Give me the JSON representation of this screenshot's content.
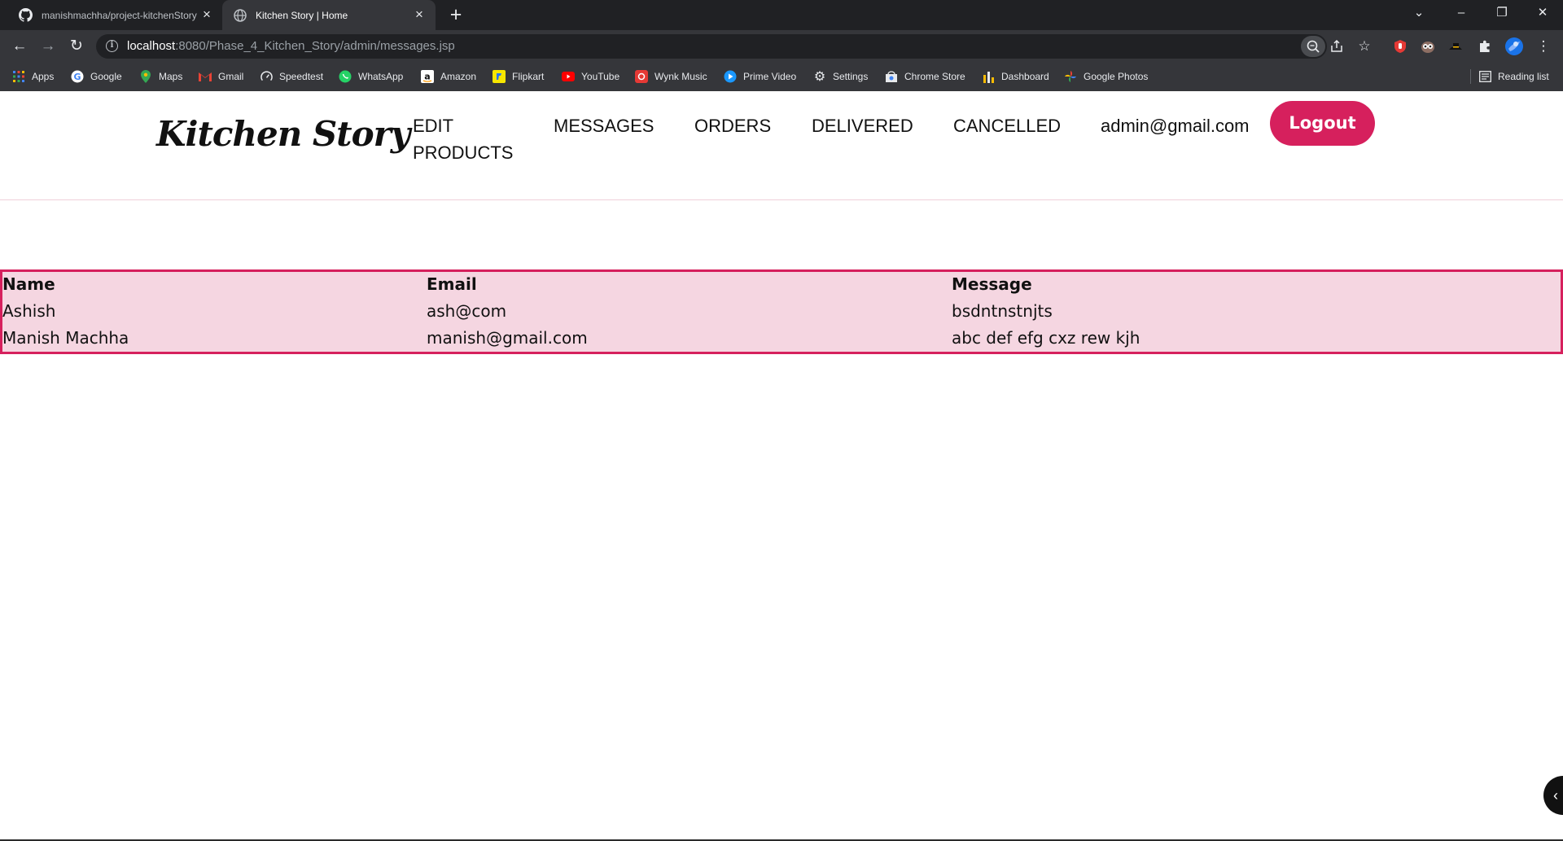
{
  "browser": {
    "tabs": [
      {
        "title": "manishmachha/project-kitchenStory",
        "icon": "github-icon"
      },
      {
        "title": "Kitchen Story | Home",
        "icon": "globe-icon"
      }
    ],
    "url_host": "localhost",
    "url_path": ":8080/Phase_4_Kitchen_Story/admin/messages.jsp",
    "bookmarks": [
      {
        "label": "Apps",
        "icon": "apps-grid-icon",
        "color": "#4285f4"
      },
      {
        "label": "Google",
        "icon": "google-icon",
        "color": "#4285f4"
      },
      {
        "label": "Maps",
        "icon": "maps-pin-icon",
        "color": "#34a853"
      },
      {
        "label": "Gmail",
        "icon": "gmail-icon",
        "color": "#ea4335"
      },
      {
        "label": "Speedtest",
        "icon": "speedtest-icon",
        "color": "#e8eaed"
      },
      {
        "label": "WhatsApp",
        "icon": "whatsapp-icon",
        "color": "#25d366"
      },
      {
        "label": "Amazon",
        "icon": "amazon-icon",
        "color": "#ffffff"
      },
      {
        "label": "Flipkart",
        "icon": "flipkart-icon",
        "color": "#f7e600"
      },
      {
        "label": "YouTube",
        "icon": "youtube-icon",
        "color": "#ff0000"
      },
      {
        "label": "Wynk Music",
        "icon": "wynk-icon",
        "color": "#e53935"
      },
      {
        "label": "Prime Video",
        "icon": "prime-video-icon",
        "color": "#1a98ff"
      },
      {
        "label": "Settings",
        "icon": "gear-icon",
        "color": "#e8eaed"
      },
      {
        "label": "Chrome Store",
        "icon": "chrome-store-icon",
        "color": "#e8eaed"
      },
      {
        "label": "Dashboard",
        "icon": "dashboard-icon",
        "color": "#fbbc04"
      },
      {
        "label": "Google Photos",
        "icon": "google-photos-icon",
        "color": "#fbbc04"
      }
    ],
    "reading_list": "Reading list"
  },
  "header": {
    "logo": "Kitchen Story",
    "nav": {
      "edit_products": "EDIT PRODUCTS",
      "messages": "MESSAGES",
      "orders": "ORDERS",
      "delivered": "DELIVERED",
      "cancelled": "CANCELLED",
      "user_email": "admin@gmail.com"
    },
    "logout_label": "Logout"
  },
  "messages_table": {
    "columns": [
      "Name",
      "Email",
      "Message"
    ],
    "rows": [
      [
        "Ashish",
        "ash@com",
        "bsdntnstnjts"
      ],
      [
        "Manish Machha",
        "manish@gmail.com",
        "abc def efg cxz rew kjh"
      ]
    ]
  },
  "colors": {
    "accent": "#d6205d",
    "table_bg": "#f5d6e1",
    "chrome_dark": "#202124",
    "chrome_toolbar": "#35363a"
  }
}
